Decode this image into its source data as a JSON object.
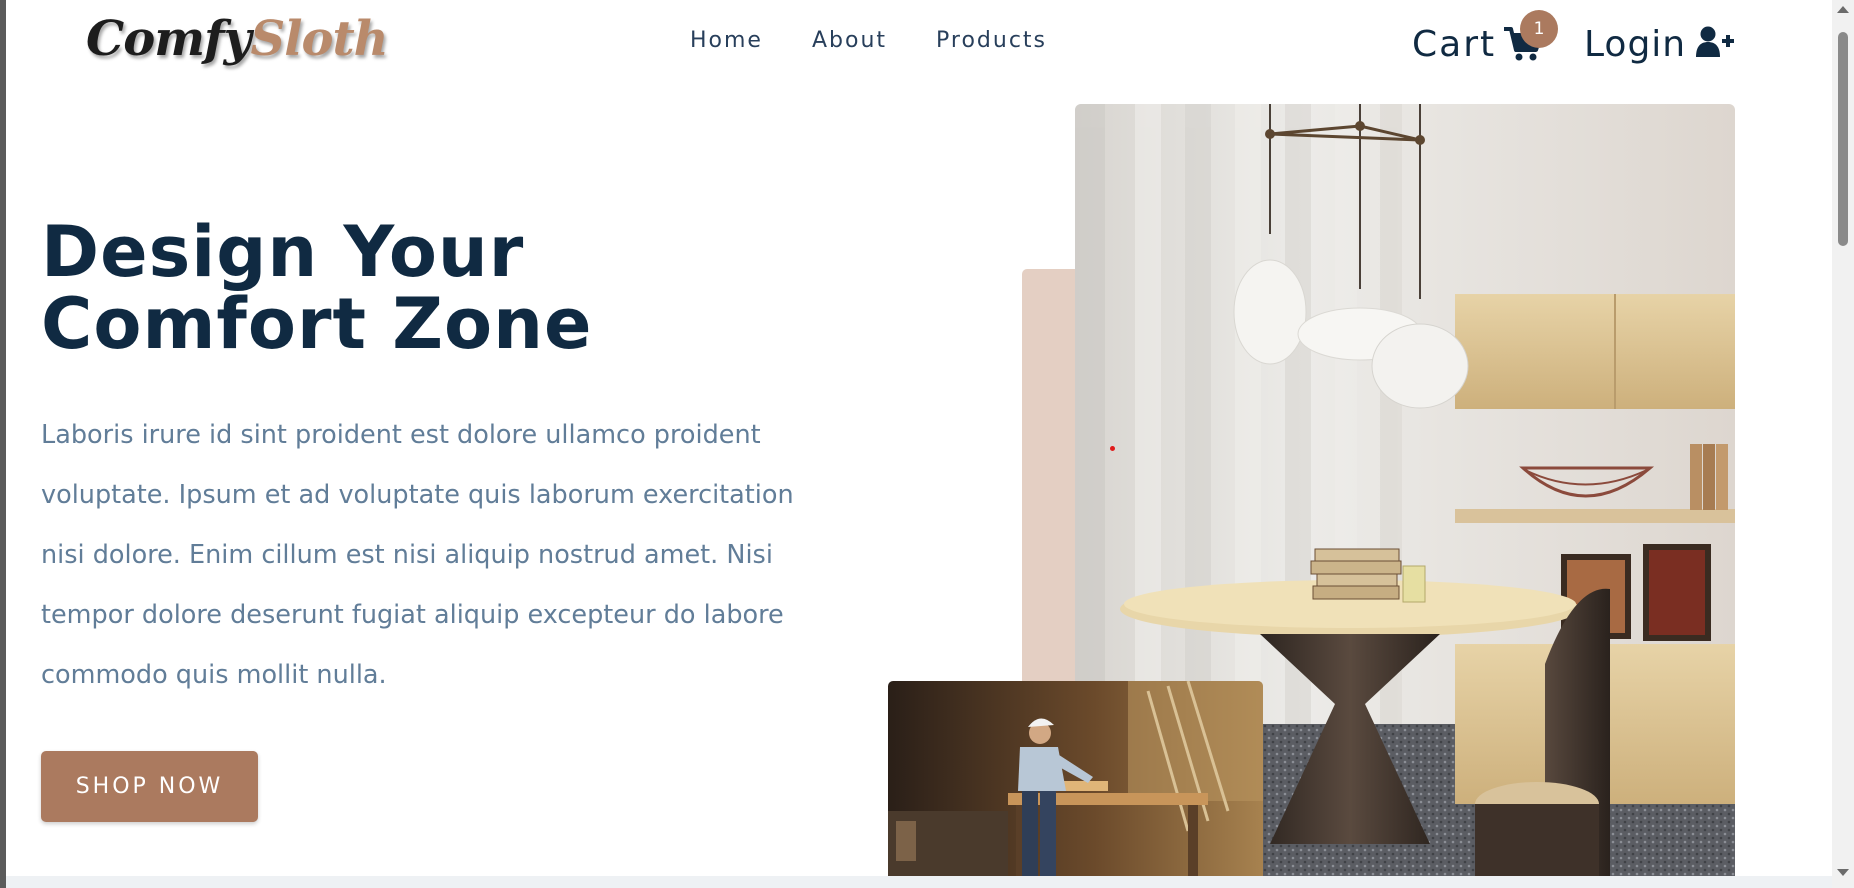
{
  "brand": {
    "logo_part1": "Comfy",
    "logo_part2": "Sloth"
  },
  "nav": {
    "links": [
      "Home",
      "About",
      "Products"
    ]
  },
  "cart": {
    "label": "Cart",
    "count": "1",
    "icon": "cart-icon"
  },
  "login": {
    "label": "Login",
    "icon": "user-plus-icon"
  },
  "hero": {
    "title_line1": "Design Your",
    "title_line2": "Comfort Zone",
    "text": "Laboris irure id sint proident est dolore ullamco proident voluptate. Ipsum et ad voluptate quis laborum exercitation nisi dolore. Enim cillum est nisi aliquip nostrud amet. Nisi tempor dolore deserunt fugiat aliquip excepteur do labore commodo quis mollit nulla.",
    "button": "SHOP NOW"
  },
  "colors": {
    "primary": "#ab7a5f",
    "heading": "#102a42",
    "text": "#617d98",
    "accent": "#e4cfc3"
  }
}
